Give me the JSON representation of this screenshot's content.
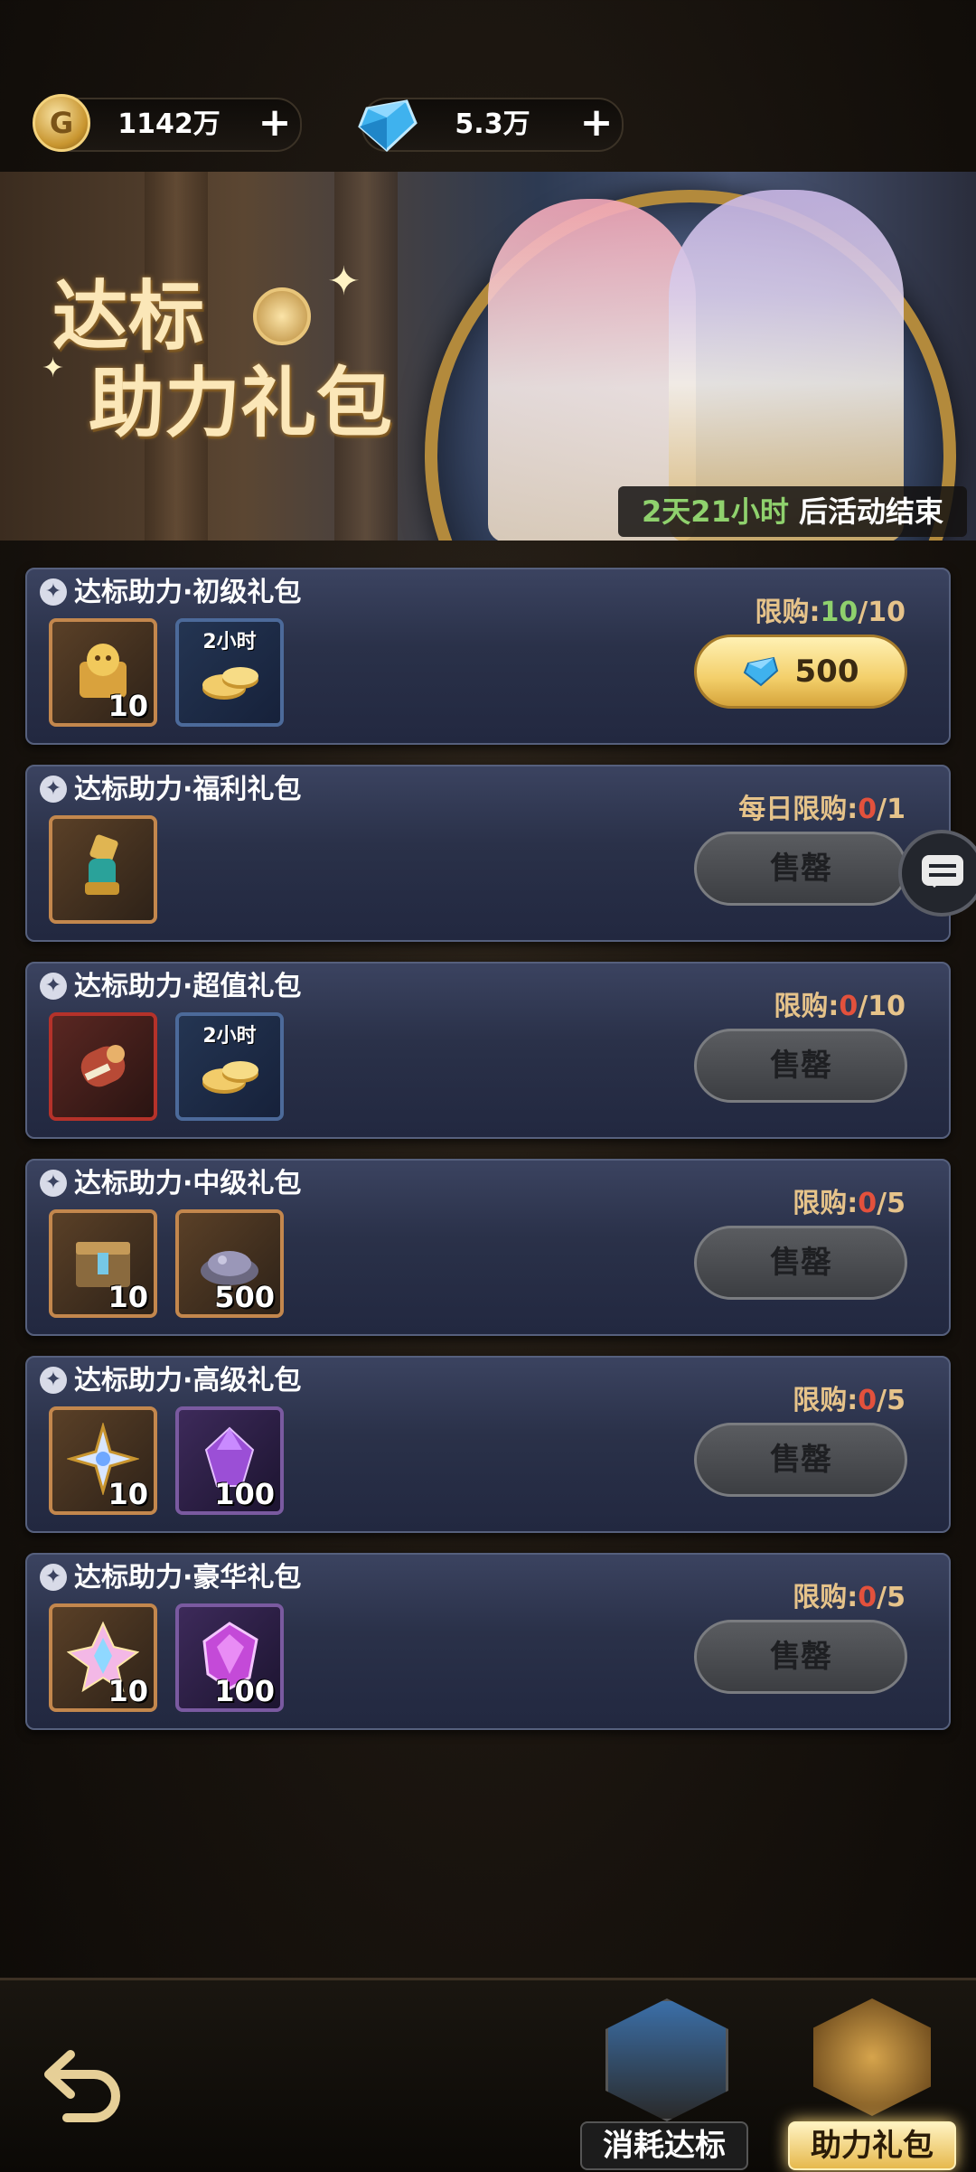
{
  "currency": {
    "gold": {
      "amount": "1142万",
      "icon": "gold-coin-icon",
      "add_label": "+"
    },
    "diamond": {
      "amount": "5.3万",
      "icon": "diamond-icon",
      "add_label": "+"
    }
  },
  "banner": {
    "title_line1": "达标",
    "title_line2": "助力礼包",
    "timer_highlight": "2天21小时",
    "timer_suffix": " 后活动结束"
  },
  "packs": [
    {
      "title": "达标助力·初级礼包",
      "limit_label": "限购:",
      "used": "10",
      "max": "/10",
      "items": [
        {
          "count": "10",
          "tag": ""
        },
        {
          "count": "",
          "tag": "2小时"
        }
      ],
      "button": {
        "type": "buy",
        "price": "500"
      }
    },
    {
      "title": "达标助力·福利礼包",
      "limit_label": "每日限购:",
      "used": "0",
      "max": "/1",
      "items": [
        {
          "count": "",
          "tag": ""
        }
      ],
      "button": {
        "type": "sold",
        "label": "售罄"
      }
    },
    {
      "title": "达标助力·超值礼包",
      "limit_label": "限购:",
      "used": "0",
      "max": "/10",
      "items": [
        {
          "count": "",
          "tag": ""
        },
        {
          "count": "",
          "tag": "2小时"
        }
      ],
      "button": {
        "type": "sold",
        "label": "售罄"
      }
    },
    {
      "title": "达标助力·中级礼包",
      "limit_label": "限购:",
      "used": "0",
      "max": "/5",
      "items": [
        {
          "count": "10",
          "tag": ""
        },
        {
          "count": "500",
          "tag": ""
        }
      ],
      "button": {
        "type": "sold",
        "label": "售罄"
      }
    },
    {
      "title": "达标助力·高级礼包",
      "limit_label": "限购:",
      "used": "0",
      "max": "/5",
      "items": [
        {
          "count": "10",
          "tag": ""
        },
        {
          "count": "100",
          "tag": ""
        }
      ],
      "button": {
        "type": "sold",
        "label": "售罄"
      }
    },
    {
      "title": "达标助力·豪华礼包",
      "limit_label": "限购:",
      "used": "0",
      "max": "/5",
      "items": [
        {
          "count": "10",
          "tag": ""
        },
        {
          "count": "100",
          "tag": ""
        }
      ],
      "button": {
        "type": "sold",
        "label": "售罄"
      }
    }
  ],
  "bottom_nav": {
    "back_icon": "back-arrow-icon",
    "tabs": [
      {
        "label": "消耗达标",
        "active": false
      },
      {
        "label": "助力礼包",
        "active": true
      }
    ]
  },
  "colors": {
    "accent_gold": "#f3cf6a",
    "limit_used_red": "#e3513c",
    "limit_full_green": "#8fd16d",
    "timer_green": "#8fd16d"
  }
}
